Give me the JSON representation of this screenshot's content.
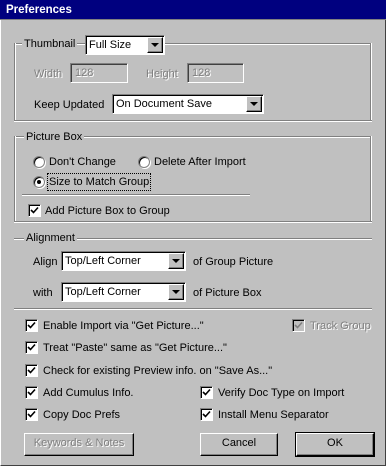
{
  "window": {
    "title": "Preferences"
  },
  "thumbnail_group": {
    "thumbnail_label": "Thumbnail",
    "thumbnail_value": "Full Size",
    "width_label": "Width",
    "width_value": "128",
    "height_label": "Height",
    "height_value": "128",
    "keep_updated_label": "Keep Updated",
    "keep_updated_value": "On Document Save"
  },
  "picture_box": {
    "label": "Picture Box",
    "radios": [
      {
        "label": "Don't Change",
        "checked": false
      },
      {
        "label": "Delete After Import",
        "checked": false
      },
      {
        "label": "Size to Match Group",
        "checked": true
      }
    ],
    "add_to_group_label": "Add Picture Box to Group",
    "add_to_group_checked": true
  },
  "alignment": {
    "label": "Alignment",
    "align_label": "Align",
    "align_value": "Top/Left Corner",
    "align_suffix": "of Group Picture",
    "with_label": "with",
    "with_value": "Top/Left Corner",
    "with_suffix": "of Picture Box"
  },
  "options": {
    "enable_import": {
      "label": "Enable Import via \"Get Picture...\"",
      "checked": true
    },
    "treat_paste": {
      "label": "Treat \"Paste\" same as \"Get Picture...\"",
      "checked": true
    },
    "check_preview": {
      "label": "Check for existing Preview info. on \"Save As...\"",
      "checked": true
    },
    "add_cumulus": {
      "label": "Add Cumulus Info.",
      "checked": true
    },
    "copy_doc_prefs": {
      "label": "Copy Doc Prefs",
      "checked": true
    },
    "track_group": {
      "label": "Track Group",
      "checked": true,
      "disabled": true
    },
    "verify_doc_type": {
      "label": "Verify Doc Type on Import",
      "checked": true
    },
    "install_menu_sep": {
      "label": "Install Menu Separator",
      "checked": true
    }
  },
  "buttons": {
    "keywords": "Keywords & Notes",
    "cancel": "Cancel",
    "ok": "OK"
  },
  "colors": {
    "titlebar": "#00007f",
    "face": "#c0c0c0"
  }
}
